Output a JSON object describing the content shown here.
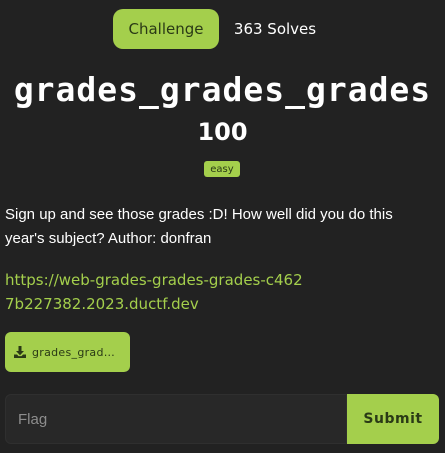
{
  "tabs": {
    "challenge": "Challenge",
    "solves": "363 Solves"
  },
  "challenge": {
    "name": "grades_grades_grades",
    "points": "100",
    "difficulty": "easy",
    "description": "Sign up and see those grades :D! How well did you do this year's subject? Author: donfran",
    "link": "https://web-grades-grades-grades-c4627b227382.2023.ductf.dev",
    "file": "grades_grades_grades.tar.gz"
  },
  "submission": {
    "placeholder": "Flag",
    "submit_label": "Submit"
  },
  "colors": {
    "accent": "#a4cf4c",
    "background": "#222222"
  }
}
